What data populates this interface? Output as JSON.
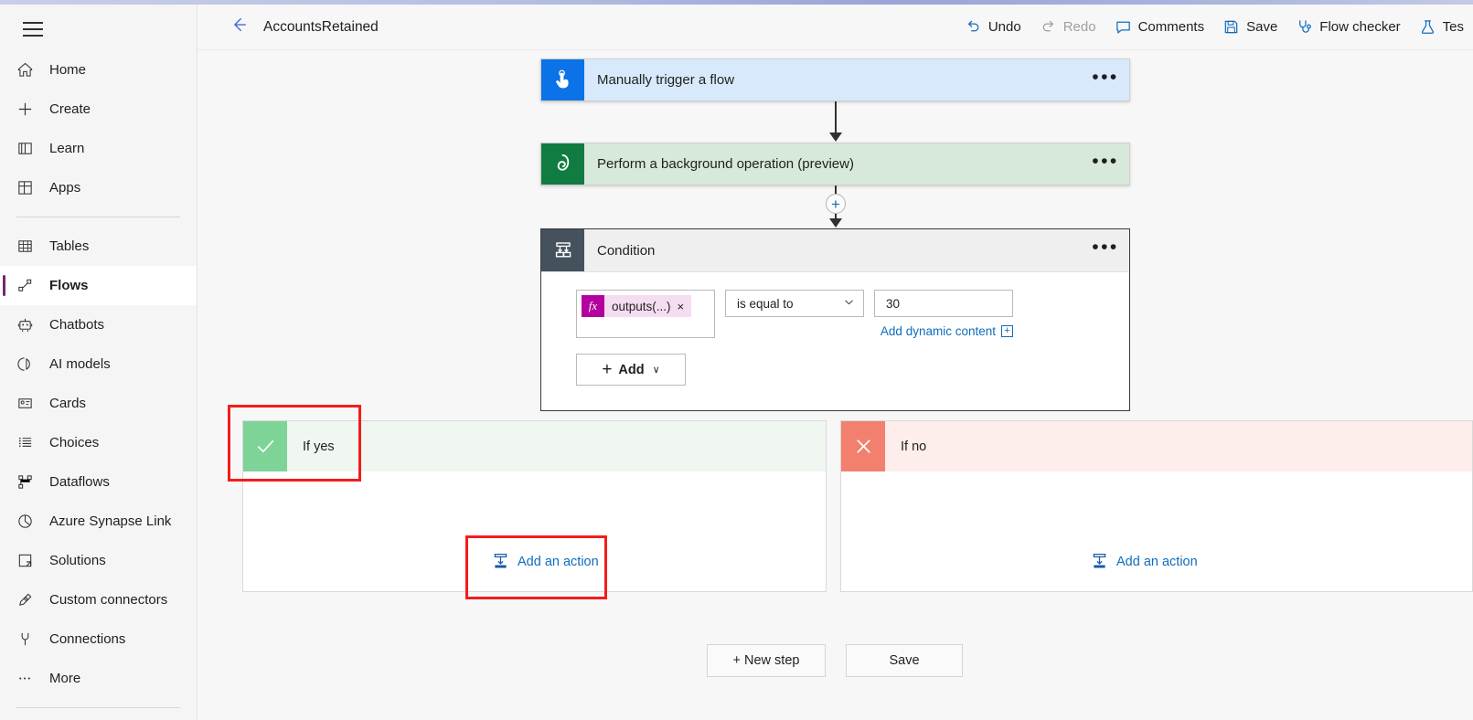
{
  "sidebar": {
    "menu_button": "menu-hamburger",
    "items": [
      {
        "label": "Home",
        "icon": "home-icon",
        "selected": false
      },
      {
        "label": "Create",
        "icon": "plus-icon",
        "selected": false
      },
      {
        "label": "Learn",
        "icon": "book-icon",
        "selected": false
      },
      {
        "label": "Apps",
        "icon": "apps-grid-icon",
        "selected": false
      },
      {
        "label": "Tables",
        "icon": "table-icon",
        "selected": false
      },
      {
        "label": "Flows",
        "icon": "flow-icon",
        "selected": true
      },
      {
        "label": "Chatbots",
        "icon": "chatbot-icon",
        "selected": false
      },
      {
        "label": "AI models",
        "icon": "ai-model-icon",
        "selected": false
      },
      {
        "label": "Cards",
        "icon": "card-icon",
        "selected": false
      },
      {
        "label": "Choices",
        "icon": "list-icon",
        "selected": false
      },
      {
        "label": "Dataflows",
        "icon": "dataflow-icon",
        "selected": false
      },
      {
        "label": "Azure Synapse Link",
        "icon": "synapse-icon",
        "selected": false
      },
      {
        "label": "Solutions",
        "icon": "solutions-icon",
        "selected": false
      },
      {
        "label": "Custom connectors",
        "icon": "custom-connector-icon",
        "selected": false
      },
      {
        "label": "Connections",
        "icon": "plug-icon",
        "selected": false
      },
      {
        "label": "More",
        "icon": "ellipsis-icon",
        "selected": false
      }
    ],
    "accent_color": "#742774"
  },
  "header": {
    "back_label": "back-arrow-icon",
    "title": "AccountsRetained",
    "tools": [
      {
        "label": "Undo",
        "icon": "undo-icon",
        "disabled": false
      },
      {
        "label": "Redo",
        "icon": "redo-icon",
        "disabled": true
      },
      {
        "label": "Comments",
        "icon": "comment-icon",
        "disabled": false
      },
      {
        "label": "Save",
        "icon": "save-disk-icon",
        "disabled": false
      },
      {
        "label": "Flow checker",
        "icon": "stethoscope-icon",
        "disabled": false
      },
      {
        "label": "Tes",
        "icon": "flask-icon",
        "disabled": false
      }
    ]
  },
  "canvas": {
    "nodes": [
      {
        "title": "Manually trigger a flow",
        "icon": "touch-tap-icon",
        "icon_color": "#0b72e7",
        "body_color": "#d7e9fb",
        "menu": "•••"
      },
      {
        "title": "Perform a background operation (preview)",
        "icon": "dataverse-icon",
        "icon_color": "#107c41",
        "body_color": "#d6e9da",
        "menu": "•••"
      },
      {
        "title": "Condition",
        "icon": "condition-branch-icon",
        "icon_color": "#46515e",
        "body_color": "#efefef",
        "menu": "•••"
      }
    ],
    "condition": {
      "token_prefix": "fx",
      "token_label": "outputs(...)",
      "token_remove": "×",
      "operator": "is equal to",
      "operator_chevron": "chevron-down-icon",
      "value": "30",
      "dynamic_content_link": "Add dynamic content",
      "dynamic_content_plus": "+",
      "add_button": "Add",
      "add_button_plus": "+",
      "add_button_chevron": "∨"
    },
    "insert_button": "+",
    "branches": [
      {
        "label": "If yes",
        "icon": "checkmark-icon",
        "icon_color": "#7ed396",
        "header_color": "#eff7f0",
        "add_action": "Add an action",
        "add_action_icon": "add-action-icon"
      },
      {
        "label": "If no",
        "icon": "cross-icon",
        "icon_color": "#f3806f",
        "header_color": "#fdeeec",
        "add_action": "Add an action",
        "add_action_icon": "add-action-icon"
      }
    ],
    "bottom_buttons": [
      {
        "label": "+ New step"
      },
      {
        "label": "Save"
      }
    ],
    "annotations": [
      {
        "name": "if-yes-highlight",
        "color": "#f41c1c"
      },
      {
        "name": "add-an-action-highlight",
        "color": "#f41c1c"
      }
    ]
  }
}
